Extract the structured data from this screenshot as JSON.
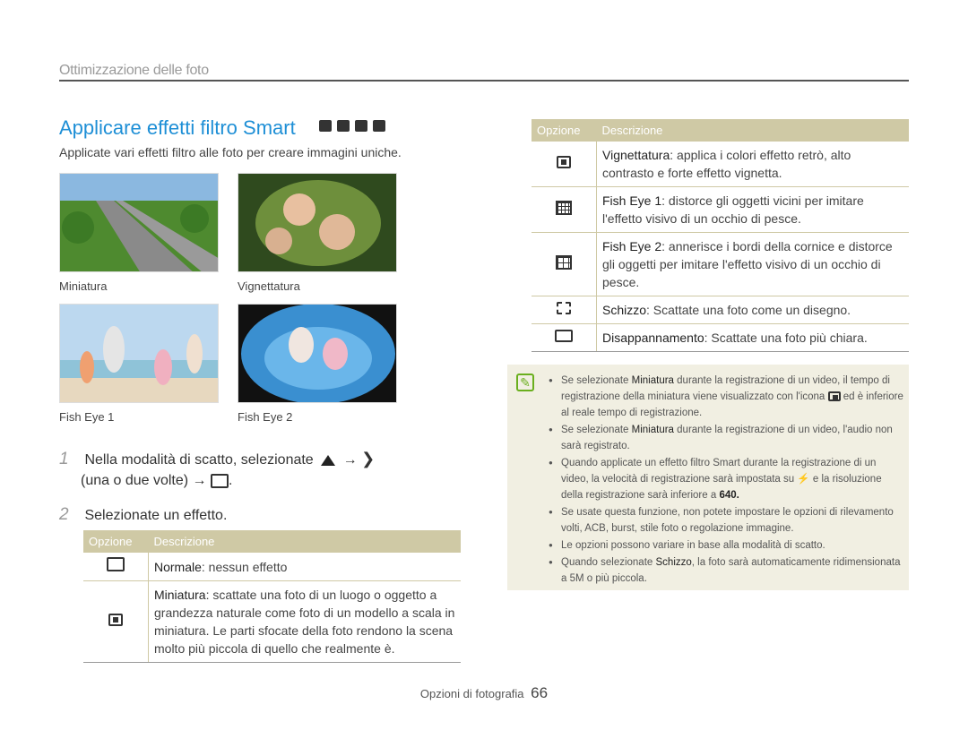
{
  "header": {
    "section": "Ottimizzazione delle foto"
  },
  "title": "Applicare effetti filtro Smart",
  "mode_icons": [
    "camera-icon",
    "smart-camera-icon",
    "dual-is-icon",
    "movie-icon"
  ],
  "intro": "Applicate vari effetti filtro alle foto per creare immagini uniche.",
  "photos": [
    {
      "caption": "Miniatura"
    },
    {
      "caption": "Vignettatura"
    },
    {
      "caption": "Fish Eye 1"
    },
    {
      "caption": "Fish Eye 2"
    }
  ],
  "steps": [
    {
      "num": "1",
      "text_a": "Nella modalità di scatto, selezionate",
      "arrow": "→",
      "text_b": "(una o due volte)",
      "arrow2": "→",
      "end": "."
    },
    {
      "num": "2",
      "text": "Selezionate un effetto."
    }
  ],
  "table_left": {
    "head": [
      "Opzione",
      "Descrizione"
    ],
    "rows": [
      {
        "name": "Normale",
        "desc": ": nessun effetto"
      },
      {
        "name": "Miniatura",
        "desc": ": scattate una foto di un luogo o oggetto a grandezza naturale come foto di un modello a scala in miniatura. Le parti sfocate della foto rendono la scena molto più piccola di quello che realmente è."
      }
    ]
  },
  "table_right": {
    "head": [
      "Opzione",
      "Descrizione"
    ],
    "rows": [
      {
        "name": "Vignettatura",
        "desc": ": applica i colori effetto retrò, alto contrasto e forte effetto vignetta."
      },
      {
        "name": "Fish Eye 1",
        "desc": ": distorce gli oggetti vicini per imitare l'effetto visivo di un occhio di pesce."
      },
      {
        "name": "Fish Eye 2",
        "desc": ": annerisce i bordi della cornice e distorce gli oggetti per imitare l'effetto visivo di un occhio di pesce."
      },
      {
        "name": "Schizzo",
        "desc": ": Scattate una foto come un disegno."
      },
      {
        "name": "Disappannamento",
        "desc": ": Scattate una foto più chiara."
      }
    ]
  },
  "notes": [
    {
      "a": "Se selezionate ",
      "b": "Miniatura",
      "c": " durante la registrazione di un video, il tempo di registrazione della miniatura viene visualizzato con l'icona ",
      "d": " ed è inferiore al reale tempo di registrazione."
    },
    {
      "a": "Se selezionate ",
      "b": "Miniatura",
      "c": " durante la registrazione di un video, l'audio non sarà registrato.",
      "d": ""
    },
    {
      "a": "Quando applicate un effetto filtro Smart durante la registrazione di un video, la velocità di registrazione sarà impostata su ",
      "b": "",
      "c": " e la risoluzione della registrazione sarà inferiore a ",
      "d": "640."
    },
    {
      "a": "Se usate questa funzione, non potete impostare le opzioni di rilevamento volti, ACB, burst, stile foto o regolazione immagine.",
      "b": "",
      "c": "",
      "d": ""
    },
    {
      "a": "Le opzioni possono variare in base alla modalità di scatto.",
      "b": "",
      "c": "",
      "d": ""
    },
    {
      "a": "Quando selezionate ",
      "b": "Schizzo",
      "c": ", la foto sarà automaticamente ridimensionata a ",
      "d": "5M o più piccola."
    }
  ],
  "footer": {
    "label": "Opzioni di fotografia",
    "page": "66"
  },
  "colors": {
    "title": "#1e8fd6",
    "table_head": "#cfc9a5",
    "note_bg": "#f1efe2",
    "note_icon": "#6aaf1e"
  }
}
